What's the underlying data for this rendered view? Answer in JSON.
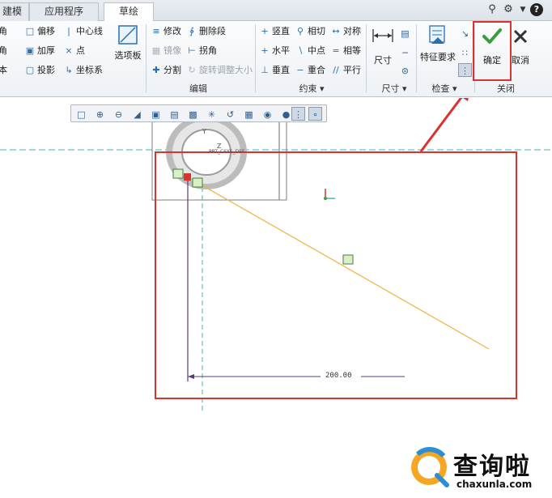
{
  "tabs": [
    {
      "label": "建模"
    },
    {
      "label": "应用程序"
    },
    {
      "label": "草绘"
    }
  ],
  "topright_icons": [
    "search-icon",
    "settings-icon",
    "chevron-down-icon",
    "help-icon"
  ],
  "ribbon": {
    "setup_col": [
      {
        "label": "角",
        "icon": "corner-icon"
      },
      {
        "label": "角",
        "icon": "chamfer-icon"
      },
      {
        "label": "本",
        "icon": "text-icon"
      }
    ],
    "offset_col": [
      {
        "label": "偏移",
        "icon": "offset-icon"
      },
      {
        "label": "加厚",
        "icon": "thicken-icon"
      },
      {
        "label": "投影",
        "icon": "project-icon"
      }
    ],
    "center_col": [
      {
        "label": "中心线",
        "icon": "centerline-icon"
      },
      {
        "label": "点",
        "icon": "point-icon"
      },
      {
        "label": "坐标系",
        "icon": "coordinate-system-icon"
      }
    ],
    "palette_label": "选项板",
    "edit_col1": [
      {
        "label": "修改",
        "icon": "modify-icon",
        "disabled": false
      },
      {
        "label": "镜像",
        "icon": "mirror-icon",
        "disabled": true
      },
      {
        "label": "分割",
        "icon": "divide-icon",
        "disabled": false
      }
    ],
    "edit_col2": [
      {
        "label": "删除段",
        "icon": "delete-segment-icon",
        "disabled": false
      },
      {
        "label": "拐角",
        "icon": "corner-trim-icon",
        "disabled": false
      },
      {
        "label": "旋转调整大小",
        "icon": "rotate-resize-icon",
        "disabled": true
      }
    ],
    "edit_group_label": "编辑",
    "cons_col1": [
      {
        "label": "竖直",
        "icon": "vertical-icon"
      },
      {
        "label": "水平",
        "icon": "horizontal-icon"
      },
      {
        "label": "垂直",
        "icon": "perpendicular-icon"
      }
    ],
    "cons_col2": [
      {
        "label": "相切",
        "icon": "tangent-icon"
      },
      {
        "label": "中点",
        "icon": "midpoint-icon"
      },
      {
        "label": "重合",
        "icon": "coincident-icon"
      }
    ],
    "cons_col3": [
      {
        "label": "对称",
        "icon": "symmetric-icon"
      },
      {
        "label": "相等",
        "icon": "equal-icon"
      },
      {
        "label": "平行",
        "icon": "parallel-icon"
      }
    ],
    "constraint_group_label": "约束",
    "dimension_label": "尺寸",
    "dimension_group_label": "尺寸",
    "feature_req_label": "特征要求",
    "inspect_group_label": "检查",
    "ok_label": "确定",
    "cancel_label": "取消",
    "close_group_label": "关闭"
  },
  "mini_toolbar": [
    "refit-icon",
    "zoom-in-icon",
    "zoom-out-icon",
    "repaint-icon",
    "display-style-icon",
    "saved-views-icon",
    "layers-icon",
    "spin-center-icon",
    "datum-display-icon",
    "view-orientation-icon",
    "shading-icon",
    "sketch-view-icon",
    "sketch-display-icon"
  ],
  "canvas": {
    "dimension_value": "200.00",
    "part_label_y": "Y",
    "part_label_z": "Z",
    "part_label_prt": "PRT_CSYS_DEF"
  },
  "watermark": {
    "title": "查询啦",
    "url": "chaxunla.com"
  },
  "colors": {
    "highlight_red": "#d9332f",
    "sketch_line": "#f0b040",
    "dimension_line": "#5a3b7a",
    "ok_green": "#3a9d3a",
    "axis_cyan": "#3fb8b0"
  }
}
